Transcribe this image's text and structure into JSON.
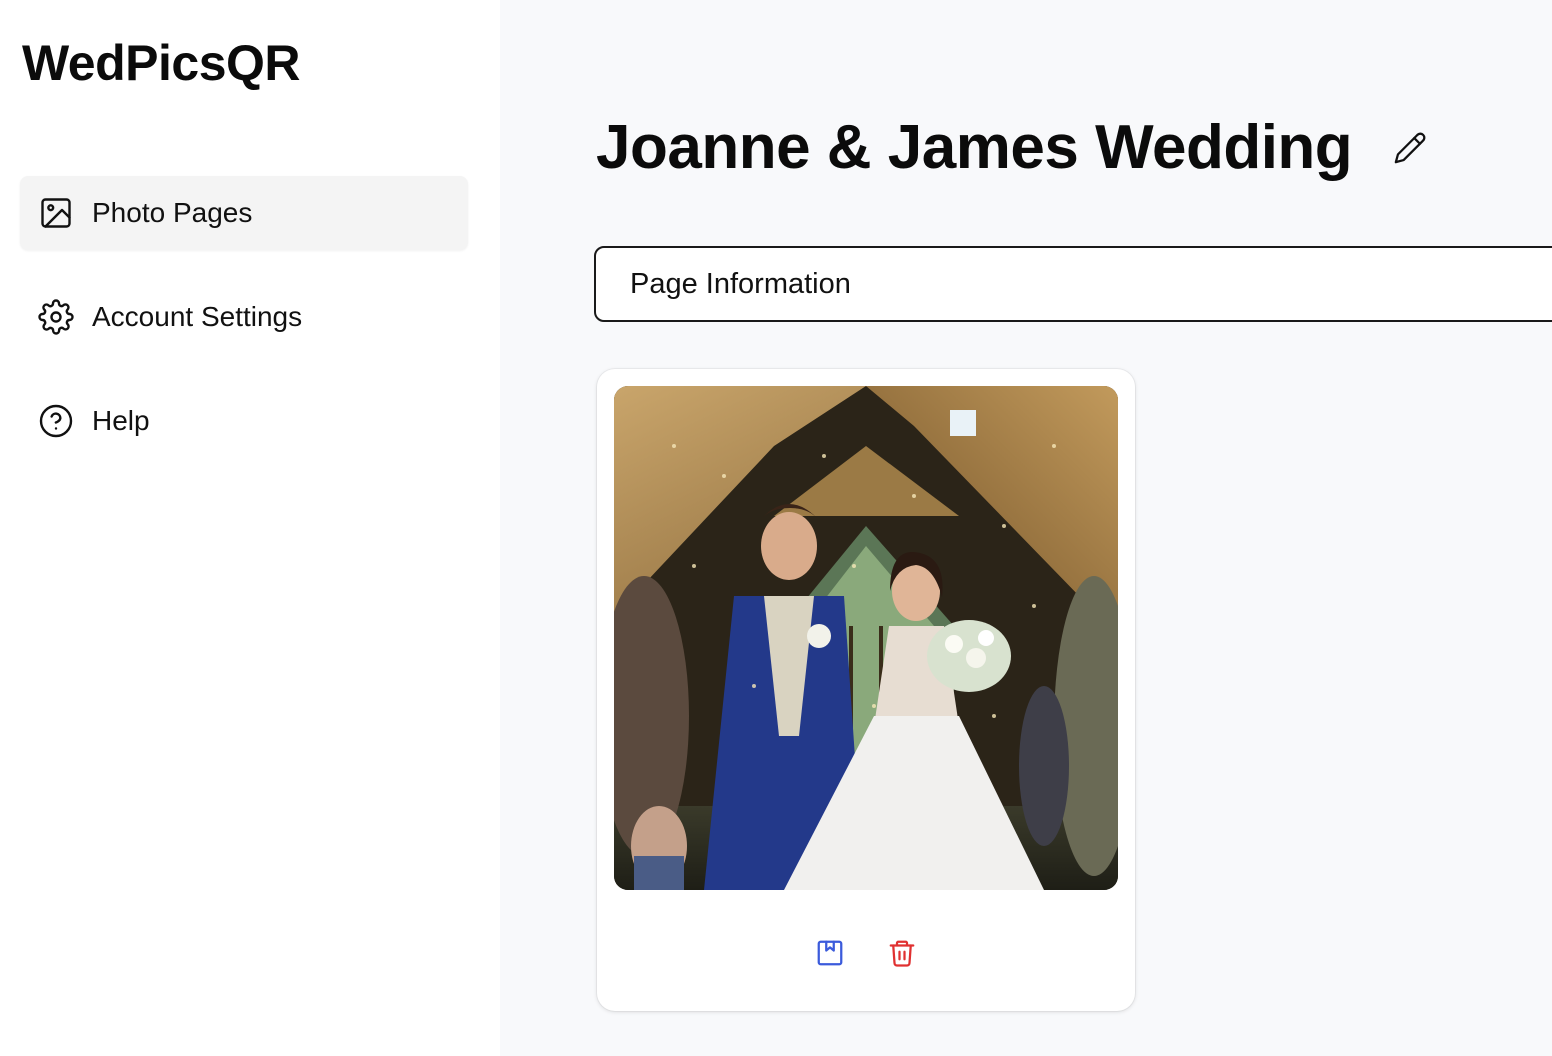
{
  "app": {
    "brand": "WedPicsQR"
  },
  "sidebar": {
    "items": [
      {
        "label": "Photo Pages",
        "icon": "image-icon",
        "active": true
      },
      {
        "label": "Account Settings",
        "icon": "gear-icon",
        "active": false
      },
      {
        "label": "Help",
        "icon": "help-circle-icon",
        "active": false
      }
    ]
  },
  "main": {
    "title": "Joanne & James Wedding",
    "edit_icon": "pencil-icon",
    "page_info_label": "Page Information",
    "photos": [
      {
        "alt": "Bride and groom walking down the aisle under a wooden chapel roof",
        "actions": [
          {
            "icon": "bookmark-icon",
            "color": "#3b5bdb"
          },
          {
            "icon": "trash-icon",
            "color": "#e03131"
          }
        ]
      }
    ]
  },
  "colors": {
    "sidebar_bg": "#ffffff",
    "main_bg": "#f8f9fb",
    "active_nav_bg": "#f4f4f4",
    "accent_blue": "#3b5bdb",
    "danger_red": "#e03131"
  }
}
